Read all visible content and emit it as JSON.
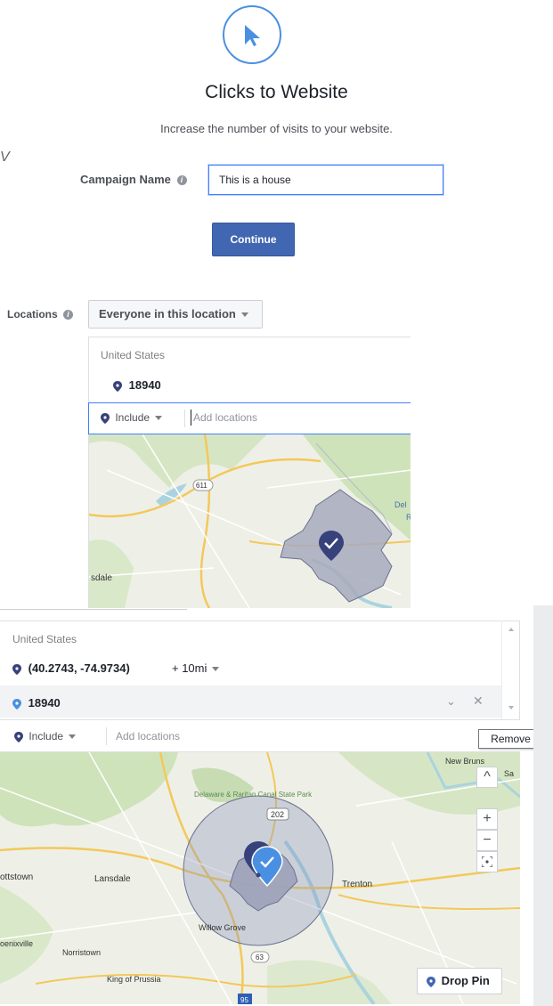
{
  "header": {
    "icon": "cursor-arrow-icon",
    "title": "Clicks to Website",
    "subtitle": "Increase the number of visits to your website.",
    "left_fragment": "V"
  },
  "campaign": {
    "label": "Campaign Name",
    "info_icon": "i",
    "value": "This is a house",
    "continue_label": "Continue"
  },
  "panel1": {
    "locations_label": "Locations",
    "audience_dropdown": "Everyone in this location",
    "country": "United States",
    "location": "18940",
    "include_label": "Include",
    "add_placeholder": "Add locations",
    "map_labels": [
      "611",
      "sdale",
      "Del",
      "R"
    ]
  },
  "panel2": {
    "country": "United States",
    "coordinate": "(40.2743, -74.9734)",
    "radius": "+ 10mi",
    "zip": "18940",
    "include_label": "Include",
    "add_placeholder": "Add locations",
    "tooltip": "Remove",
    "map_labels": {
      "new_brunswick": "New Bruns",
      "sa": "Sa",
      "park": "Delaware & Raritan Canal State Park",
      "route_202": "202",
      "ottstown": "ottstown",
      "lansdale": "Lansdale",
      "trenton": "Trenton",
      "willow_grove": "Willow Grove",
      "phoenixville": "oenixville",
      "norristown": "Norristown",
      "king_of_prussia": "King of Prussia",
      "route_63": "63",
      "route_95": "95"
    },
    "drop_pin_label": "Drop Pin",
    "zoom_in": "+",
    "zoom_out": "−"
  },
  "colors": {
    "accent": "#4267b2",
    "focus": "#4080ff",
    "pin_dark": "#37417a",
    "pin_light": "#4a90e2",
    "radius_fill": "#a7afc4"
  }
}
